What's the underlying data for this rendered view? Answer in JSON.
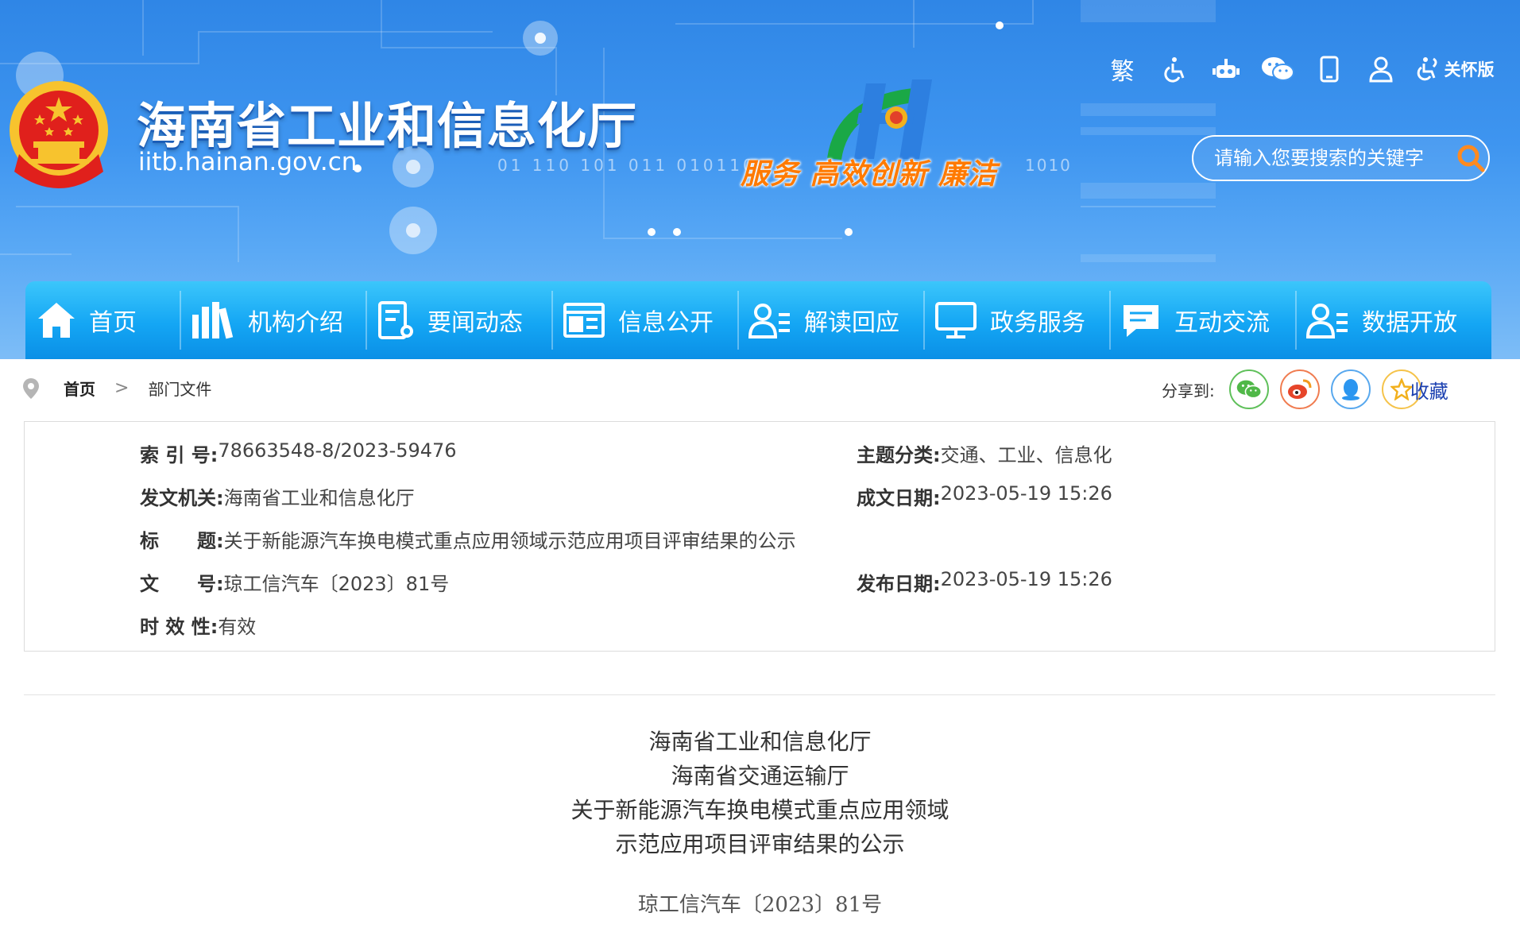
{
  "header": {
    "site_title": "海南省工业和信息化厅",
    "site_url": "iitb.hainan.gov.cn",
    "binary_left": "01 110 101 011 010110",
    "binary_right": "1010",
    "slogan": "服务 高效创新 廉洁",
    "tools": {
      "traditional": "繁",
      "care_mode": "关怀版"
    },
    "search_placeholder": "请输入您要搜索的关键字"
  },
  "nav": {
    "items": [
      {
        "label": "首页",
        "icon": "home-icon"
      },
      {
        "label": "机构介绍",
        "icon": "books-icon"
      },
      {
        "label": "要闻动态",
        "icon": "news-icon"
      },
      {
        "label": "信息公开",
        "icon": "window-icon"
      },
      {
        "label": "解读回应",
        "icon": "user-list-icon"
      },
      {
        "label": "政务服务",
        "icon": "monitor-icon"
      },
      {
        "label": "互动交流",
        "icon": "chat-icon"
      },
      {
        "label": "数据开放",
        "icon": "user-list-icon"
      }
    ]
  },
  "breadcrumb": {
    "home": "首页",
    "separator": ">",
    "current": "部门文件"
  },
  "share": {
    "label": "分享到:",
    "collect": "收藏"
  },
  "meta": {
    "index_no_label": "索 引 号:",
    "index_no": "78663548-8/2023-59476",
    "category_label": "主题分类:",
    "category": "交通、工业、信息化",
    "issuer_label": "发文机关:",
    "issuer": "海南省工业和信息化厅",
    "created_label": "成文日期:",
    "created": "2023-05-19 15:26",
    "title_label": "标　　题:",
    "title": "关于新能源汽车换电模式重点应用领域示范应用项目评审结果的公示",
    "doc_no_label": "文　　号:",
    "doc_no": "琼工信汽车〔2023〕81号",
    "published_label": "发布日期:",
    "published": "2023-05-19 15:26",
    "validity_label": "时 效 性:",
    "validity": "有效"
  },
  "document": {
    "lines": [
      "海南省工业和信息化厅",
      "海南省交通运输厅",
      "关于新能源汽车换电模式重点应用领域",
      "示范应用项目评审结果的公示"
    ],
    "doc_number": "琼工信汽车〔2023〕81号"
  },
  "colors": {
    "header_blue": "#3e95f0",
    "nav_blue": "#14a6f4",
    "slogan_orange": "#ff7a00",
    "search_icon_orange": "#ff8a1f",
    "collect_blue": "#1a3fb0"
  }
}
